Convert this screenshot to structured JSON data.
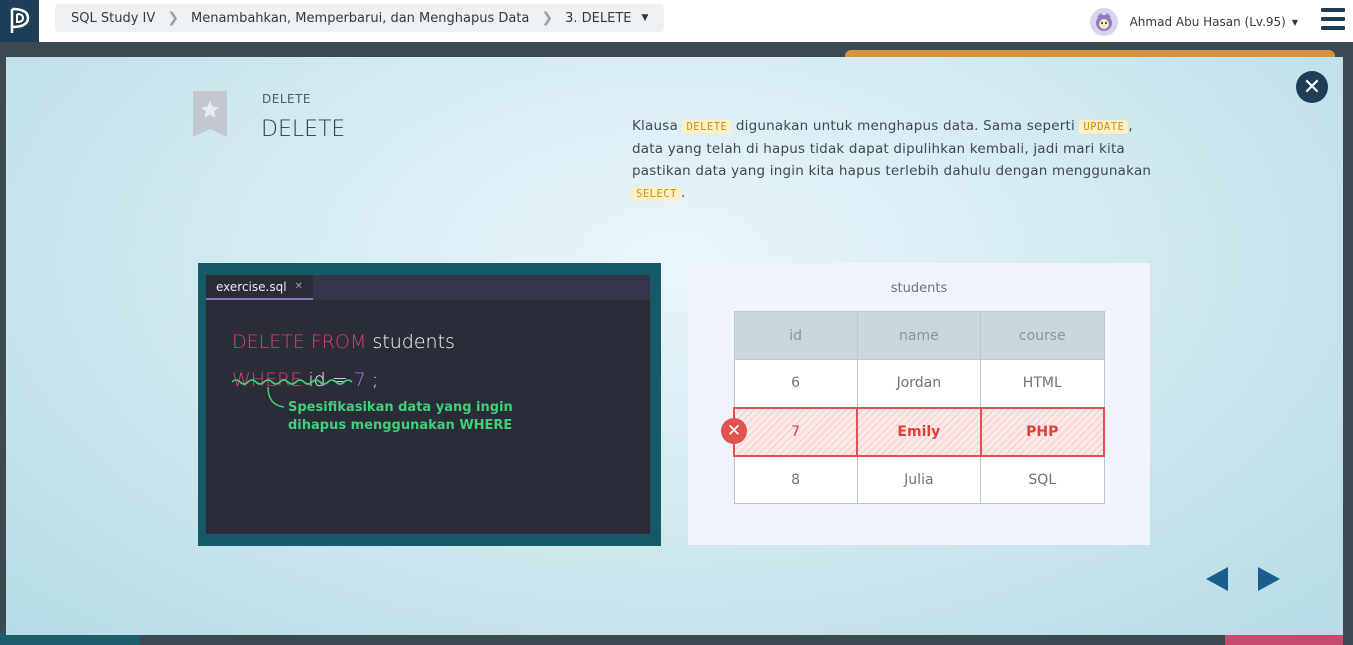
{
  "header": {
    "breadcrumbs": [
      "SQL Study IV",
      "Menambahkan, Memperbarui, dan Menghapus Data",
      "3. DELETE"
    ],
    "user": "Ahmad Abu Hasan (Lv.95)"
  },
  "lesson": {
    "subtitle": "DELETE",
    "title": "DELETE",
    "desc": {
      "p1": "Klausa ",
      "kw1": "DELETE",
      "p2": " digunakan untuk menghapus data. Sama seperti ",
      "kw2": "UPDATE",
      "p3": ", data yang telah di hapus tidak dapat dipulihkan kembali, jadi mari kita pastikan data yang ingin kita hapus terlebih dahulu dengan menggunakan ",
      "kw3": "SELECT",
      "p4": "."
    }
  },
  "editor": {
    "tab": "exercise.sql",
    "line1_kw": "DELETE FROM",
    "line1_rest": " students",
    "line2_kw": "WHERE",
    "line2_mid": " id = ",
    "line2_num": "7",
    "line2_end": " ;",
    "annotation_1": "Spesifikasikan data yang ingin",
    "annotation_2": "dihapus menggunakan WHERE"
  },
  "table": {
    "title": "students",
    "headers": [
      "id",
      "name",
      "course"
    ],
    "rows": [
      [
        "6",
        "Jordan",
        "HTML"
      ],
      [
        "7",
        "Emily",
        "PHP"
      ],
      [
        "8",
        "Julia",
        "SQL"
      ]
    ]
  },
  "colors": {
    "accent": "#1e3d57",
    "keyword": "#e23c72",
    "delete": "#e05250",
    "annotation": "#3ed07b"
  }
}
